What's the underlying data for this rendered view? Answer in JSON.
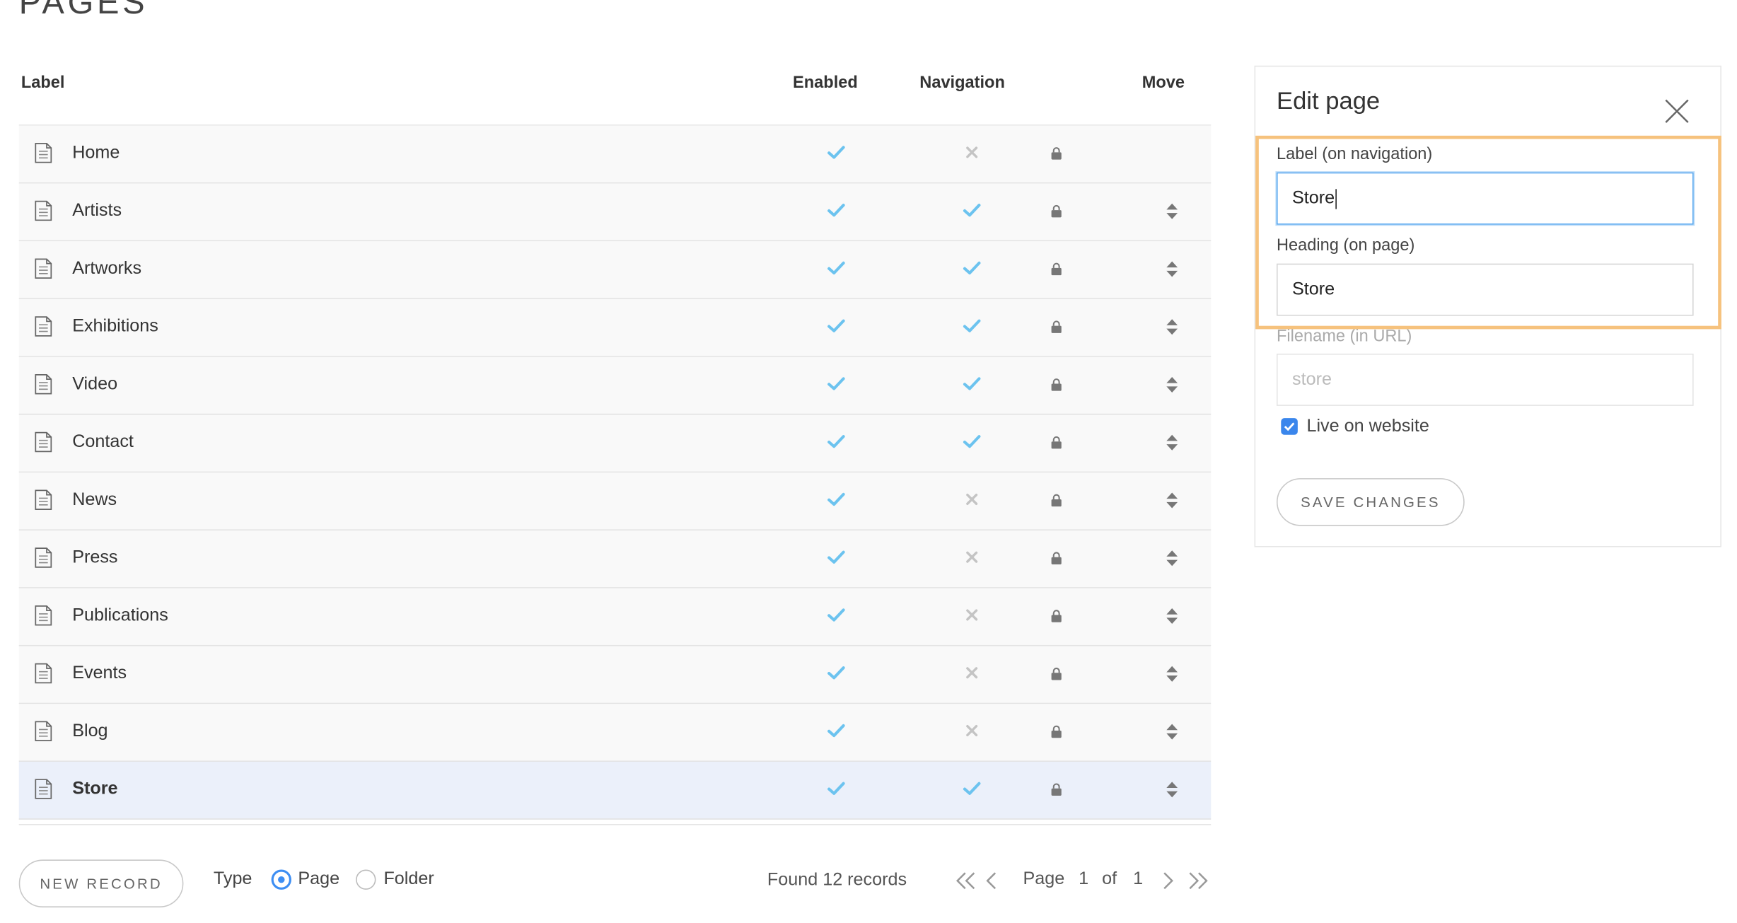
{
  "page_title": "PAGES",
  "table": {
    "headers": {
      "label": "Label",
      "enabled": "Enabled",
      "navigation": "Navigation",
      "move": "Move"
    },
    "rows": [
      {
        "label": "Home",
        "enabled": true,
        "navigation": false,
        "movable": false,
        "selected": false
      },
      {
        "label": "Artists",
        "enabled": true,
        "navigation": true,
        "movable": true,
        "selected": false
      },
      {
        "label": "Artworks",
        "enabled": true,
        "navigation": true,
        "movable": true,
        "selected": false
      },
      {
        "label": "Exhibitions",
        "enabled": true,
        "navigation": true,
        "movable": true,
        "selected": false
      },
      {
        "label": "Video",
        "enabled": true,
        "navigation": true,
        "movable": true,
        "selected": false
      },
      {
        "label": "Contact",
        "enabled": true,
        "navigation": true,
        "movable": true,
        "selected": false
      },
      {
        "label": "News",
        "enabled": true,
        "navigation": false,
        "movable": true,
        "selected": false
      },
      {
        "label": "Press",
        "enabled": true,
        "navigation": false,
        "movable": true,
        "selected": false
      },
      {
        "label": "Publications",
        "enabled": true,
        "navigation": false,
        "movable": true,
        "selected": false
      },
      {
        "label": "Events",
        "enabled": true,
        "navigation": false,
        "movable": true,
        "selected": false
      },
      {
        "label": "Blog",
        "enabled": true,
        "navigation": false,
        "movable": true,
        "selected": false
      },
      {
        "label": "Store",
        "enabled": true,
        "navigation": true,
        "movable": true,
        "selected": true
      }
    ]
  },
  "footer": {
    "new_record": "NEW RECORD",
    "type_label": "Type",
    "type_options": [
      "Page",
      "Folder"
    ],
    "type_selected": "Page",
    "found": "Found 12 records",
    "page_label": "Page",
    "page_current": "1",
    "of_label": "of",
    "page_total": "1"
  },
  "edit_panel": {
    "title": "Edit page",
    "label_field": {
      "label": "Label (on navigation)",
      "value": "Store"
    },
    "heading_field": {
      "label": "Heading (on page)",
      "value": "Store"
    },
    "filename_field": {
      "label": "Filename (in URL)",
      "placeholder": "store"
    },
    "live_checkbox": {
      "label": "Live on website",
      "checked": true
    },
    "save_button": "SAVE CHANGES"
  },
  "colors": {
    "check": "#6cc3ef",
    "cross": "#c4c4c4",
    "accent": "#3d8ef3",
    "highlight": "#f6c27d",
    "selected_row": "#ebf0fa"
  }
}
